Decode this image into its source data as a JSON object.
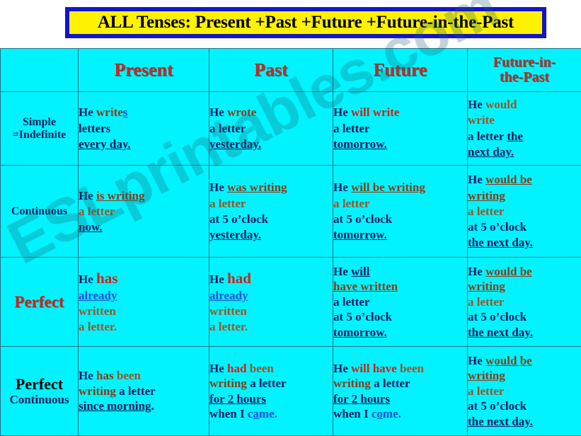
{
  "title": {
    "text": "ALL Tenses: Present +Past +Future +Future-in-the-Past",
    "fill_color": "#FFF200",
    "border_color": "#1414C8",
    "text_color": "#000000"
  },
  "watermark": {
    "text": "ESLprintables.com",
    "color": "rgba(30,95,110,0.27)"
  },
  "colors": {
    "cell_background": "#00F3FF",
    "grid_line": "#2a6f86",
    "heading_red": "#C62A20",
    "navy": "#0B1A5C",
    "red": "#D12216",
    "maroon": "#8A3B14",
    "brown": "#9C5522",
    "blue": "#1C4FD8"
  },
  "table": {
    "column_headers": {
      "corner": "",
      "present": "Present",
      "past": "Past",
      "future": "Future",
      "future_in_the_past_line1": "Future-in-",
      "future_in_the_past_line2": "the-Past"
    },
    "rows": {
      "simple": {
        "label_line1": "Simple",
        "label_line2": "=Indefinite",
        "present": {
          "l1a": "He ",
          "l1b": "write",
          "l1c": "s",
          "l2": "letters",
          "l3": "every day."
        },
        "past": {
          "l1a": "He ",
          "l1b": "wrote",
          "l2": "a letter",
          "l3": "yesterday."
        },
        "future": {
          "l1a": "He ",
          "l1b": "will write",
          "l2": "a letter",
          "l3": "tomorrow."
        },
        "fip": {
          "l1a": "He ",
          "l1b": "would",
          "l2": "write",
          "l3a": "a letter ",
          "l3b": "the",
          "l4": "next day."
        }
      },
      "continuous": {
        "label": "Continuous",
        "present": {
          "l1a": "He ",
          "l1b": "is writing",
          "l2": "a letter",
          "l3": "now."
        },
        "past": {
          "l1a": "He ",
          "l1b": "was  writing",
          "l2": "a letter",
          "l3": "at 5 o’clock",
          "l4": "yesterday."
        },
        "future": {
          "l1a": "He ",
          "l1b": "will be writing",
          "l2": "a letter",
          "l3": "at 5 o’clock",
          "l4": "tomorrow."
        },
        "fip": {
          "l1a": "He ",
          "l1b": "would be",
          "l2": "writing",
          "l3": "a letter",
          "l4": "at 5 o’clock",
          "l5": "the next day."
        }
      },
      "perfect": {
        "label": "Perfect",
        "present": {
          "l1a": "He ",
          "l1b": "has",
          "l2": "already",
          "l3": "written",
          "l4": "a letter."
        },
        "past": {
          "l1a": "He ",
          "l1b": "had",
          "l2": "already",
          "l3": "written",
          "l4": "a letter."
        },
        "future": {
          "l1a": "He ",
          "l1b": "will",
          "l2": "have  written",
          "l3": "a letter",
          "l4": "at 5 o’clock",
          "l5": "tomorrow."
        },
        "fip": {
          "l1a": "He ",
          "l1b": "would be",
          "l2": "writing",
          "l3": "a letter",
          "l4": "at 5 o’clock",
          "l5": "the next day."
        }
      },
      "perfect_continuous": {
        "label_line1": "Perfect",
        "label_line2": "Continuous",
        "present": {
          "l1a": "He ",
          "l1b": "has",
          "l1c": " been",
          "l2a": "writing",
          "l2b": " a letter",
          "l3a": "since morning",
          "l3b": "."
        },
        "past": {
          "l1a": "He ",
          "l1b": "had",
          "l1c": " been",
          "l2a": "writing",
          "l2b": " a letter",
          "l3": "for 2 hours",
          "l4a": "when I ",
          "l4b": "c",
          "l4c": "a",
          "l4d": "me."
        },
        "future": {
          "l1a": "He ",
          "l1b": "will have",
          "l1c": " been",
          "l2a": "writing",
          "l2b": " a letter",
          "l3": "for 2 hours",
          "l4a": "when I ",
          "l4b": "c",
          "l4c": "o",
          "l4d": "me."
        },
        "fip": {
          "l1a": "He ",
          "l1b": "would be",
          "l2": "writing",
          "l3": "a letter",
          "l4": "at 5 o’clock",
          "l5": "the next day."
        }
      }
    }
  }
}
